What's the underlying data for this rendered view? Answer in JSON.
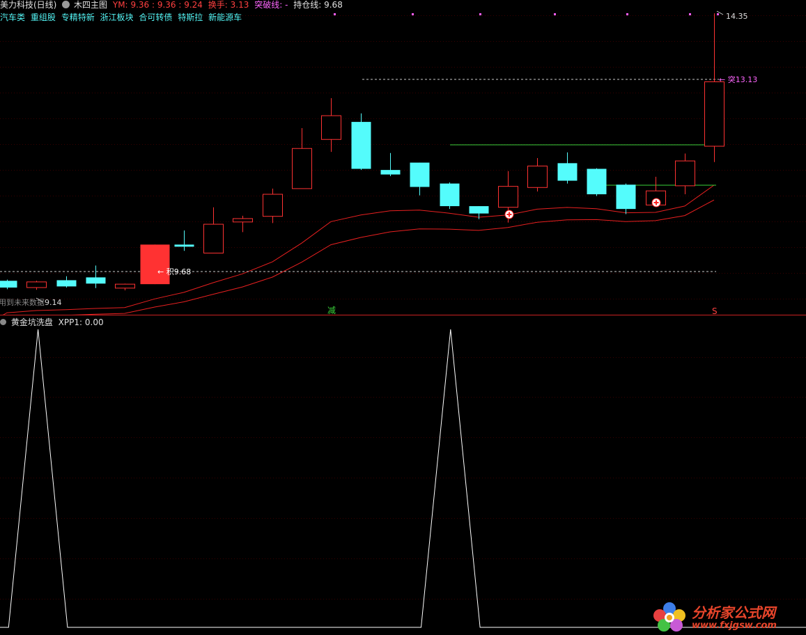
{
  "header": {
    "stock_name": "美力科技(日线)",
    "indicator_name": "木四主图",
    "ym_label": "YM:",
    "ym_values": "9.36 : 9.36 : 9.24",
    "turnover_label": "换手:",
    "turnover_value": "3.13",
    "breakthrough_label": "突破线:",
    "breakthrough_value": "-",
    "position_label": "持仓线:",
    "position_value": "9.68",
    "concepts": [
      "汽车类",
      "重组股",
      "专精特新",
      "浙江板块",
      "合可转债",
      "特斯拉",
      "新能源车"
    ]
  },
  "main_chart": {
    "high_label": "14.35",
    "breakout_label": "← 突13.13",
    "entry_label": "← 积9.68",
    "low_label": "9.14",
    "future_data_label": "用到未来数据",
    "signal_jian": "减",
    "signal_s": "S",
    "colors": {
      "up": "#ff3232",
      "down": "#54fcfc",
      "ma": "#e82020",
      "signal": "#ff5fff"
    },
    "candles": [
      {
        "o": 9.62,
        "c": 9.5,
        "h": 9.64,
        "l": 9.47
      },
      {
        "o": 9.5,
        "c": 9.6,
        "h": 9.62,
        "l": 9.46
      },
      {
        "o": 9.63,
        "c": 9.52,
        "h": 9.7,
        "l": 9.5
      },
      {
        "o": 9.68,
        "c": 9.57,
        "h": 9.89,
        "l": 9.49
      },
      {
        "o": 9.49,
        "c": 9.56,
        "h": 9.57,
        "l": 9.45
      },
      {
        "o": 9.56,
        "c": 10.26,
        "h": 10.26,
        "l": 9.56
      },
      {
        "o": 10.26,
        "c": 10.23,
        "h": 10.51,
        "l": 10.15
      },
      {
        "o": 10.11,
        "c": 10.62,
        "h": 10.92,
        "l": 10.11
      },
      {
        "o": 10.66,
        "c": 10.72,
        "h": 10.77,
        "l": 10.48
      },
      {
        "o": 10.76,
        "c": 11.15,
        "h": 11.25,
        "l": 10.64
      },
      {
        "o": 11.25,
        "c": 11.96,
        "h": 12.32,
        "l": 11.25
      },
      {
        "o": 12.12,
        "c": 12.54,
        "h": 12.85,
        "l": 11.9
      },
      {
        "o": 12.43,
        "c": 11.6,
        "h": 12.58,
        "l": 11.58
      },
      {
        "o": 11.58,
        "c": 11.5,
        "h": 11.88,
        "l": 11.47
      },
      {
        "o": 11.71,
        "c": 11.28,
        "h": 11.71,
        "l": 11.13
      },
      {
        "o": 11.34,
        "c": 10.94,
        "h": 11.36,
        "l": 10.89
      },
      {
        "o": 10.94,
        "c": 10.81,
        "h": 10.94,
        "l": 10.71
      },
      {
        "o": 10.92,
        "c": 11.29,
        "h": 11.56,
        "l": 10.65
      },
      {
        "o": 11.27,
        "c": 11.65,
        "h": 11.79,
        "l": 11.2
      },
      {
        "o": 11.7,
        "c": 11.39,
        "h": 11.89,
        "l": 11.34
      },
      {
        "o": 11.6,
        "c": 11.15,
        "h": 11.61,
        "l": 11.12
      },
      {
        "o": 11.32,
        "c": 10.89,
        "h": 11.34,
        "l": 10.8
      },
      {
        "o": 10.96,
        "c": 11.21,
        "h": 11.46,
        "l": 10.96
      },
      {
        "o": 11.3,
        "c": 11.74,
        "h": 11.87,
        "l": 11.15
      },
      {
        "o": 12.0,
        "c": 13.14,
        "h": 14.35,
        "l": 11.72
      }
    ]
  },
  "sub_chart": {
    "title": "黄金坑洗盘",
    "series_label": "XPP1:",
    "series_value": "0.00",
    "line_color": "#ffffff",
    "values": [
      0,
      0,
      1,
      0,
      0,
      0,
      0,
      0,
      0,
      0,
      0,
      0,
      0,
      0,
      0,
      0,
      1,
      0,
      0,
      0,
      0,
      0,
      0,
      0,
      0,
      0
    ]
  },
  "watermark": {
    "site_name": "分析家公式网",
    "url": "www.fxjgsw.com"
  }
}
